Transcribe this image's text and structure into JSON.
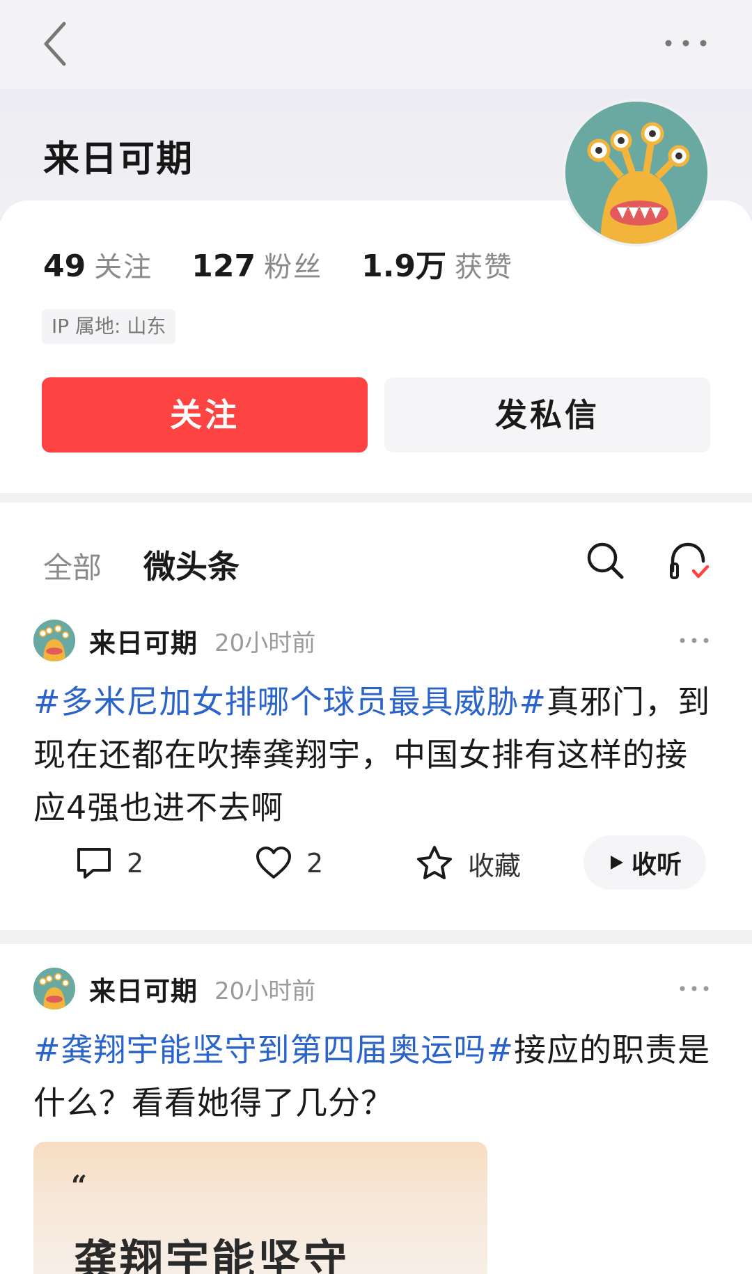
{
  "profile": {
    "name": "来日可期",
    "stats": [
      {
        "value": "49",
        "label": "关注"
      },
      {
        "value": "127",
        "label": "粉丝"
      },
      {
        "value": "1.9万",
        "label": "获赞"
      }
    ],
    "ip_location": "IP 属地: 山东",
    "follow_label": "关注",
    "message_label": "发私信"
  },
  "tabs": [
    {
      "label": "全部",
      "active": false
    },
    {
      "label": "微头条",
      "active": true
    }
  ],
  "posts": [
    {
      "author": "来日可期",
      "time": "20小时前",
      "hashtag": "#多米尼加女排哪个球员最具威胁#",
      "text": "真邪门，到现在还都在吹捧龚翔宇，中国女排有这样的接应4强也进不去啊",
      "comments": "2",
      "likes": "2",
      "collect_label": "收藏",
      "listen_label": "收听"
    },
    {
      "author": "来日可期",
      "time": "20小时前",
      "hashtag": "#龚翔宇能坚守到第四届奥运吗#",
      "text": "接应的职责是什么？看看她得了几分？",
      "image_quote": "“",
      "image_title": "龚翔宇能坚守"
    }
  ],
  "colors": {
    "accent_red": "#fd4442",
    "hashtag_blue": "#2a63c9",
    "avatar_bg": "#6aa9a2"
  },
  "icons": [
    "back-icon",
    "more-icon",
    "search-icon",
    "headphones-check-icon",
    "comment-icon",
    "heart-icon",
    "star-icon",
    "play-icon"
  ]
}
